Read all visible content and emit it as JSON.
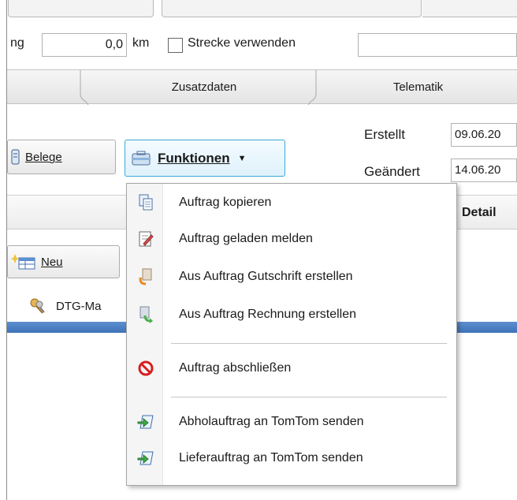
{
  "distance_row": {
    "label_fragment": "ng",
    "distance_value": "0,0",
    "unit": "km",
    "use_route_label": "Strecke verwenden"
  },
  "tabs": [
    {
      "label": "Zusatzdaten"
    },
    {
      "label": "Telematik"
    }
  ],
  "meta": {
    "created_label": "Erstellt",
    "created_value": "09.06.20",
    "changed_label": "Geändert",
    "changed_value": "14.06.20"
  },
  "buttons": {
    "belege": "Belege",
    "funktionen": "Funktionen",
    "neu": "Neu"
  },
  "grid": {
    "detail_header": "Detail"
  },
  "tree": {
    "item_label": "DTG-Ma"
  },
  "menu": {
    "items": [
      {
        "label": "Auftrag kopieren",
        "icon": "copy-icon"
      },
      {
        "label": "Auftrag geladen melden",
        "icon": "report-icon"
      },
      {
        "label": "Aus Auftrag Gutschrift erstellen",
        "icon": "credit-note-icon"
      },
      {
        "label": "Aus Auftrag Rechnung erstellen",
        "icon": "invoice-icon"
      },
      {
        "label": "Auftrag abschließen",
        "icon": "stop-icon"
      },
      {
        "label": "Abholauftrag an TomTom senden",
        "icon": "send-icon"
      },
      {
        "label": "Lieferauftrag an TomTom senden",
        "icon": "send-icon"
      }
    ]
  }
}
